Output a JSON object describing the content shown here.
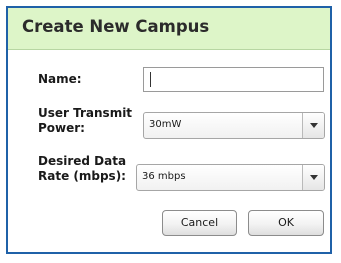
{
  "dialog": {
    "title": "Create New Campus",
    "name_label": "Name:",
    "name_value": "",
    "transmit_label_line1": "User Transmit",
    "transmit_label_line2": "Power:",
    "transmit_value": "30mW",
    "rate_label_line1": "Desired Data",
    "rate_label_line2": "Rate (mbps):",
    "rate_value": "36 mbps",
    "cancel_label": "Cancel",
    "ok_label": "OK"
  },
  "colors": {
    "header_background": "#ddf5c8",
    "border": "#1f61a8"
  },
  "icons": {
    "dropdown": "chevron-down-icon"
  }
}
